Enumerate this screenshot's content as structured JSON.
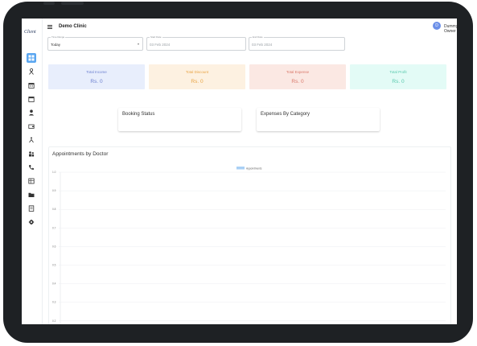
{
  "sidebar": {
    "logo_text": "Client",
    "items": [
      {
        "icon": "dashboard-icon",
        "active": true
      },
      {
        "icon": "person-icon",
        "active": false
      },
      {
        "icon": "calendar-icon",
        "active": false
      },
      {
        "icon": "calendar-blank-icon",
        "active": false
      },
      {
        "icon": "doctor-icon",
        "active": false
      },
      {
        "icon": "wallet-icon",
        "active": false
      },
      {
        "icon": "accessibility-icon",
        "active": false
      },
      {
        "icon": "group-icon",
        "active": false
      },
      {
        "icon": "phone-icon",
        "active": false
      },
      {
        "icon": "table-icon",
        "active": false
      },
      {
        "icon": "folder-icon",
        "active": false
      },
      {
        "icon": "report-icon",
        "active": false
      },
      {
        "icon": "settings-icon",
        "active": false
      }
    ]
  },
  "header": {
    "clinic_name": "Demo Clinic",
    "avatar_initial": "D",
    "user_name": "Dummy Owner"
  },
  "filters": {
    "time_range": {
      "label": "Time Range",
      "value": "Today"
    },
    "start_date": {
      "label": "Start Date",
      "value": "03 Feb 2024"
    },
    "end_date": {
      "label": "End Date",
      "value": "03 Feb 2024"
    }
  },
  "stats": [
    {
      "title": "Total Income",
      "value": "Rs. 0",
      "bg": "#e8eefc",
      "color": "#6b7fcf"
    },
    {
      "title": "Total Discount",
      "value": "Rs. 0",
      "bg": "#fdf1e1",
      "color": "#e8a445"
    },
    {
      "title": "Total Expense",
      "value": "Rs. 0",
      "bg": "#fbe8e3",
      "color": "#d9786a"
    },
    {
      "title": "Total Profit",
      "value": "Rs. 0",
      "bg": "#e3fbf6",
      "color": "#57c9ad"
    }
  ],
  "cards": {
    "booking_status": "Booking Status",
    "expenses_by_category": "Expenses By Category"
  },
  "chart_data": {
    "type": "bar",
    "title": "Appointments by Doctor",
    "series": [
      {
        "name": "Appointments",
        "values": [],
        "color": "#a9d0f5"
      }
    ],
    "categories": [],
    "ylim": [
      0,
      1
    ],
    "yticks": [
      "1.0",
      "0.9",
      "0.8",
      "0.7",
      "0.6",
      "0.5",
      "0.4",
      "0.3",
      "0.2"
    ],
    "legend": "top-center",
    "grid": true
  }
}
